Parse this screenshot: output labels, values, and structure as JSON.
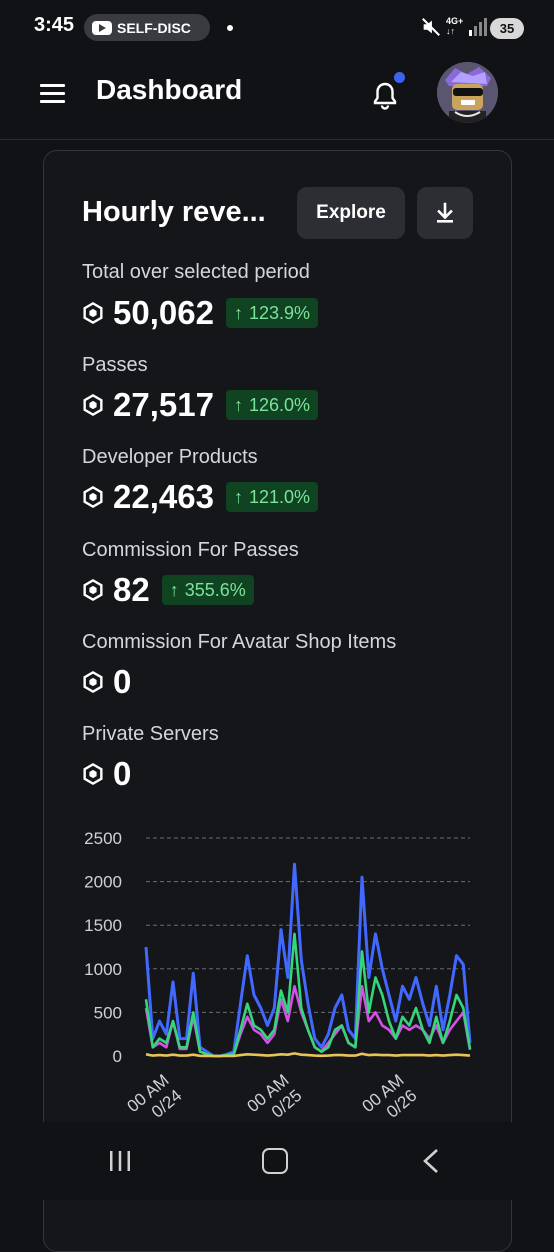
{
  "status_bar": {
    "time": "3:45",
    "notification_pill": "SELF-DISC",
    "network": "4G+",
    "battery": "35"
  },
  "header": {
    "title": "Dashboard",
    "notification_dot_color": "#3b63f6"
  },
  "card": {
    "title": "Hourly reve...",
    "explore_label": "Explore",
    "metrics": [
      {
        "label": "Total over selected period",
        "value": "50,062",
        "change": "123.9%"
      },
      {
        "label": "Passes",
        "value": "27,517",
        "change": "126.0%"
      },
      {
        "label": "Developer Products",
        "value": "22,463",
        "change": "121.0%"
      },
      {
        "label": "Commission For Passes",
        "value": "82",
        "change": "355.6%"
      },
      {
        "label": "Commission For Avatar Shop Items",
        "value": "0",
        "change": ""
      },
      {
        "label": "Private Servers",
        "value": "0",
        "change": ""
      }
    ]
  },
  "colors": {
    "badge_bg": "#0f4321",
    "badge_text": "#7be39a",
    "series_total": "#4169ff",
    "series_passes": "#34d67a",
    "series_products": "#d451e8",
    "series_commission": "#e7c45a"
  },
  "chart_data": {
    "type": "line",
    "ylim": [
      0,
      2500
    ],
    "yticks": [
      "2500",
      "2000",
      "1500",
      "1000",
      "500",
      "0"
    ],
    "xticks": [
      "00 AM\n0/24",
      "00 AM\n0/25",
      "00 AM\n0/26"
    ],
    "grid": true,
    "series": [
      {
        "values": [
          1250,
          200,
          400,
          250,
          850,
          200,
          200,
          950,
          100,
          50,
          0,
          0,
          20,
          50,
          600,
          1150,
          700,
          550,
          350,
          550,
          1450,
          900,
          2200,
          1100,
          600,
          200,
          100,
          250,
          550,
          700,
          300,
          200,
          2050,
          900,
          1400,
          1000,
          700,
          400,
          800,
          650,
          900,
          600,
          350,
          800,
          300,
          700,
          1150,
          1050,
          150
        ]
      },
      {
        "values": [
          650,
          100,
          200,
          150,
          400,
          100,
          100,
          500,
          50,
          20,
          0,
          0,
          10,
          20,
          300,
          600,
          350,
          300,
          200,
          300,
          750,
          500,
          1400,
          550,
          300,
          100,
          50,
          100,
          300,
          350,
          150,
          100,
          1200,
          500,
          900,
          700,
          400,
          200,
          450,
          350,
          550,
          300,
          150,
          450,
          150,
          400,
          700,
          550,
          80
        ]
      },
      {
        "values": [
          550,
          100,
          150,
          100,
          400,
          80,
          80,
          450,
          50,
          20,
          0,
          0,
          10,
          20,
          250,
          450,
          300,
          250,
          150,
          250,
          650,
          400,
          800,
          500,
          300,
          100,
          50,
          150,
          250,
          350,
          150,
          100,
          800,
          400,
          500,
          350,
          300,
          200,
          350,
          300,
          350,
          300,
          200,
          350,
          150,
          300,
          400,
          500,
          70
        ]
      },
      {
        "values": [
          20,
          5,
          10,
          5,
          15,
          5,
          5,
          15,
          2,
          0,
          0,
          0,
          0,
          0,
          10,
          20,
          15,
          10,
          5,
          10,
          20,
          15,
          30,
          15,
          10,
          5,
          2,
          5,
          10,
          10,
          5,
          5,
          25,
          10,
          15,
          10,
          10,
          5,
          10,
          10,
          10,
          10,
          5,
          10,
          5,
          10,
          15,
          10,
          5
        ]
      }
    ]
  }
}
